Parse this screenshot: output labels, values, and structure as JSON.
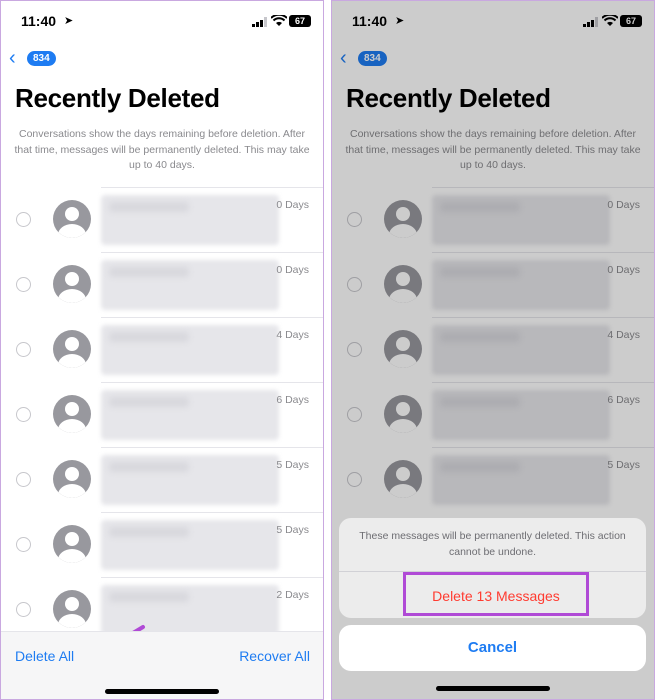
{
  "status": {
    "time": "11:40",
    "battery": "67"
  },
  "back": {
    "count": "834"
  },
  "title": "Recently Deleted",
  "description": "Conversations show the days remaining before deletion. After that time, messages will be permanently deleted. This may take up to 40 days.",
  "left_rows": [
    {
      "days": "0 Days"
    },
    {
      "days": "0 Days"
    },
    {
      "days": "4 Days"
    },
    {
      "days": "6 Days"
    },
    {
      "days": "5 Days"
    },
    {
      "days": "5 Days"
    },
    {
      "days": "2 Days"
    }
  ],
  "right_rows": [
    {
      "days": "0 Days"
    },
    {
      "days": "0 Days"
    },
    {
      "days": "4 Days"
    },
    {
      "days": "6 Days"
    },
    {
      "days": "5 Days"
    }
  ],
  "toolbar": {
    "delete_all": "Delete All",
    "recover_all": "Recover All"
  },
  "sheet": {
    "message": "These messages will be permanently deleted. This action cannot be undone.",
    "delete_label": "Delete 13 Messages",
    "cancel_label": "Cancel"
  },
  "colors": {
    "accent": "#1e7cf2",
    "destructive": "#ff3b30",
    "highlight": "#b04ad6"
  }
}
